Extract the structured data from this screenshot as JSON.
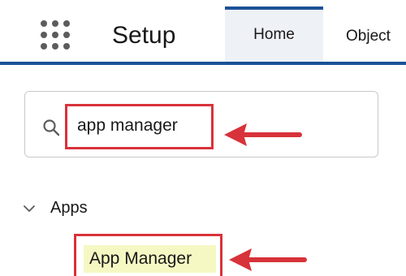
{
  "header": {
    "app_launcher_icon": "app-launcher-waffle-icon",
    "app_name": "Setup",
    "tabs": [
      {
        "label": "Home",
        "active": true
      },
      {
        "label": "Object"
      }
    ]
  },
  "quick_find": {
    "search_icon": "search-icon",
    "value": "app manager"
  },
  "tree": {
    "section": {
      "expanded_icon": "chevron-down-icon",
      "label": "Apps",
      "items": [
        {
          "label": "App Manager",
          "highlighted": true
        }
      ]
    }
  },
  "annotations": {
    "highlight_color": "#d8323a",
    "arrow_color": "#d8323a"
  },
  "colors": {
    "accent": "#1b5297",
    "match_highlight": "#f6f8c3"
  }
}
